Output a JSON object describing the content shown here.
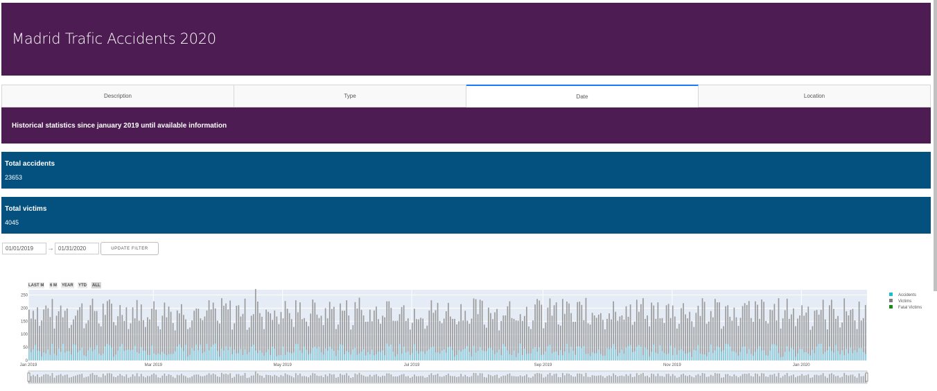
{
  "header": {
    "title": "Madrid Trafic Accidents 2020"
  },
  "tabs": [
    {
      "label": "Description",
      "active": false
    },
    {
      "label": "Type",
      "active": false
    },
    {
      "label": "Date",
      "active": true
    },
    {
      "label": "Location",
      "active": false
    }
  ],
  "banner": {
    "text": "Historical statistics since january 2019 until available information"
  },
  "stats": {
    "accidents": {
      "label": "Total accidents",
      "value": "23653"
    },
    "victims": {
      "label": "Total victims",
      "value": "4045"
    }
  },
  "date_range": {
    "start": "01/01/2019",
    "end": "01/31/2020",
    "arrow": "→",
    "button": "UPDATE FILTER"
  },
  "range_selector": [
    {
      "label": "LAST M",
      "active": false
    },
    {
      "label": "6 M",
      "active": false
    },
    {
      "label": "YEAR",
      "active": false
    },
    {
      "label": "YTD",
      "active": false
    },
    {
      "label": "ALL",
      "active": true
    }
  ],
  "colors": {
    "header_bg": "#4d1c52",
    "stat_bg": "#04517f",
    "plot_bg": "#e5ecf6",
    "accidents": "#17becf",
    "victims": "#7f7f7f",
    "fatal": "#138d13"
  },
  "chart_data": {
    "type": "bar",
    "barmode": "overlay",
    "x_range": [
      "2019-01-01",
      "2020-01-31"
    ],
    "x_ticks": [
      "Jan 2019",
      "Mar 2019",
      "May 2019",
      "Jul 2019",
      "Sep 2019",
      "Nov 2019",
      "Jan 2020"
    ],
    "y_ticks": [
      0,
      50,
      100,
      150,
      200,
      250
    ],
    "ylim": [
      0,
      270
    ],
    "legend_position": "right",
    "series": [
      {
        "name": "Accidents",
        "approx_range": [
          20,
          90
        ],
        "typical": 60
      },
      {
        "name": "Victims",
        "approx_range": [
          50,
          275
        ],
        "typical": 150
      },
      {
        "name": "Fatal Victims",
        "approx_range": [
          0,
          2
        ],
        "typical": 0
      }
    ],
    "notable": [
      {
        "date": "2019-04-18",
        "series": "Victims",
        "value": 273
      },
      {
        "date": "2019-06-06",
        "series": "Victims",
        "value": 240
      },
      {
        "date": "2019-11-21",
        "series": "Victims",
        "value": 235
      }
    ],
    "rangeslider": true
  }
}
